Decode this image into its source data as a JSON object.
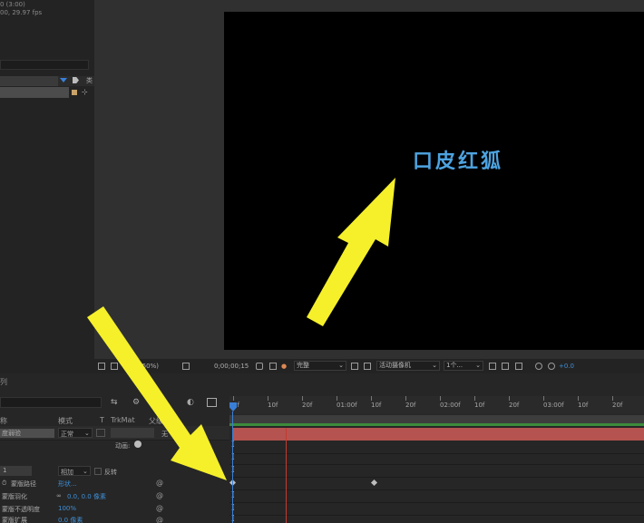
{
  "project": {
    "info_line1": "0 (3:00)",
    "info_line2": "00, 29.97 fps"
  },
  "viewer": {
    "canvas_text": "口皮红狐",
    "toolbar": {
      "zoom": "(50%)",
      "timecode": "0;00;00;15",
      "resolution": "完整",
      "camera": "活动摄像机",
      "view": "1个...",
      "exposure": "+0.0"
    }
  },
  "timeline": {
    "tab_label": "列",
    "ruler_ticks": [
      "0f",
      "10f",
      "20f",
      "01:00f",
      "10f",
      "20f",
      "02:00f",
      "10f",
      "20f",
      "03:00f",
      "10f",
      "20f"
    ],
    "columns": {
      "name": "称",
      "mode": "模式",
      "t": "T",
      "trkmat": "TrkMat",
      "parent": "父级"
    },
    "layer": {
      "name": "度弱验",
      "mode": "正常",
      "parent_short": "无",
      "animate_label": "动画:"
    },
    "sub_row": {
      "index": "1",
      "blend": "相加",
      "invert": "反转"
    },
    "properties": [
      {
        "label": "蒙版路径",
        "value": "形状..."
      },
      {
        "label": "蒙版羽化",
        "value": "0.0, 0.0 像素"
      },
      {
        "label": "蒙版不透明度",
        "value": "100%"
      },
      {
        "label": "蒙版扩展",
        "value": "0.0 像素"
      }
    ]
  },
  "colors": {
    "accent": "#3a7fd6",
    "layer_bar": "#b4534f",
    "canvas_text": "#4da3e0",
    "arrow": "#f5f02a"
  }
}
